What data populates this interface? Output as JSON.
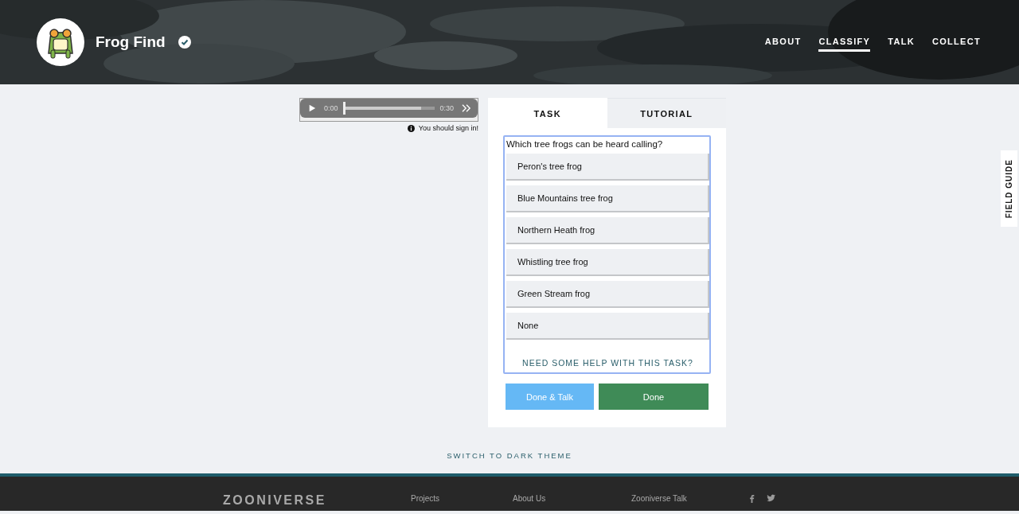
{
  "header": {
    "title": "Frog Find",
    "verified": true
  },
  "nav": [
    {
      "label": "ABOUT",
      "selected": false
    },
    {
      "label": "CLASSIFY",
      "selected": true
    },
    {
      "label": "TALK",
      "selected": false
    },
    {
      "label": "COLLECT",
      "selected": false
    }
  ],
  "player": {
    "current_time": "0:00",
    "duration": "0:30",
    "level": 0,
    "buffer": {
      "level": 0.85
    }
  },
  "sign_in_note": "You should sign in!",
  "tabs": [
    {
      "label": "TASK",
      "selected": true
    },
    {
      "label": "TUTORIAL",
      "selected": false
    }
  ],
  "question": "Which tree frogs can be heard calling?",
  "answers": [
    "Peron's tree frog",
    "Blue Mountains tree frog",
    "Northern Heath frog",
    "Whistling tree frog",
    "Green Stream frog",
    "None"
  ],
  "help_link": "NEED SOME HELP WITH THIS TASK?",
  "buttons": [
    {
      "label": "Done & Talk",
      "kind": "secondary"
    },
    {
      "label": "Done",
      "kind": "primary"
    }
  ],
  "field_guide": "FIELD GUIDE",
  "theme_toggle": "SWITCH TO DARK THEME",
  "footer": {
    "logo": "ZOONIVERSE",
    "columns": [
      [
        "Projects"
      ],
      [
        "About Us"
      ],
      [
        "Zooniverse Talk"
      ]
    ],
    "social": [
      {
        "kind": "facebook"
      },
      {
        "kind": "twitter"
      }
    ]
  }
}
